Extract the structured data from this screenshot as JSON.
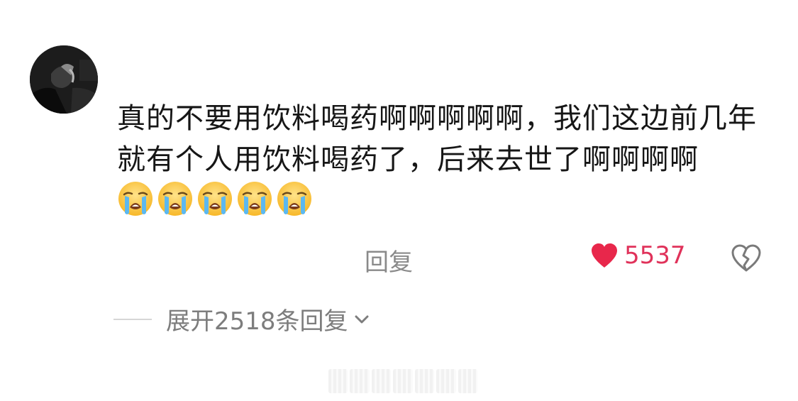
{
  "comment": {
    "text": "真的不要用饮料喝药啊啊啊啊啊，我们这边前几年就有个人用饮料喝药了，后来去世了啊啊啊啊",
    "emojis": [
      "loudly-crying-face",
      "loudly-crying-face",
      "loudly-crying-face",
      "loudly-crying-face",
      "loudly-crying-face"
    ]
  },
  "actions": {
    "reply_label": "回复",
    "like_count": "5537",
    "like_color": "#e8274b",
    "dislike_icon": "broken-heart-icon"
  },
  "replies": {
    "expand_label": "展开2518条回复",
    "expand_icon": "chevron-down-icon"
  }
}
